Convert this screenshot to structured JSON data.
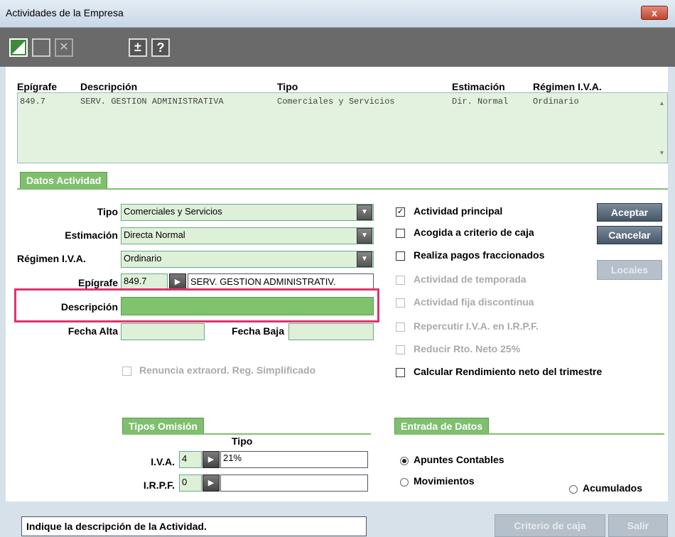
{
  "window": {
    "title": "Actividades de la Empresa",
    "close_label": "x"
  },
  "toolbar": {
    "help_label": "?"
  },
  "list": {
    "headers": [
      "Epígrafe",
      "Descripción",
      "Tipo",
      "Estimación",
      "Régimen I.V.A."
    ],
    "rows": [
      [
        "849.7",
        "SERV. GESTION ADMINISTRATIVA",
        "Comerciales y Servicios",
        "Dir. Normal",
        "Ordinario"
      ]
    ]
  },
  "datos": {
    "tab": "Datos Actividad",
    "tipo_label": "Tipo",
    "tipo_value": "Comerciales y Servicios",
    "estimacion_label": "Estimación",
    "estimacion_value": "Directa Normal",
    "regimen_label": "Régimen I.V.A.",
    "regimen_value": "Ordinario",
    "epigrafe_label": "Epígrafe",
    "epigrafe_code": "849.7",
    "epigrafe_desc": "SERV. GESTION ADMINISTRATIV.",
    "descripcion_label": "Descripción",
    "descripcion_value": "",
    "fecha_alta_label": "Fecha Alta",
    "fecha_baja_label": "Fecha Baja",
    "renuncia_label": "Renuncia extraord. Reg. Simplificado"
  },
  "checks": {
    "principal": "Actividad principal",
    "caja": "Acogida a criterio de caja",
    "fraccionados": "Realiza pagos fraccionados",
    "temporada": "Actividad de temporada",
    "discontinua": "Actividad fija discontinua",
    "repercutir": "Repercutir I.V.A. en I.R.P.F.",
    "reducir": "Reducir Rto. Neto 25%",
    "calcular": "Calcular Rendimiento neto del trimestre",
    "checkmark": "✓"
  },
  "buttons": {
    "aceptar": "Aceptar",
    "cancelar": "Cancelar",
    "locales": "Locales",
    "criterio": "Criterio de caja",
    "salir": "Salir"
  },
  "tipos": {
    "tab": "Tipos Omisión",
    "col": "Tipo",
    "iva_label": "I.V.A.",
    "iva_code": "4",
    "iva_value": "21%",
    "irpf_label": "I.R.P.F.",
    "irpf_code": "0",
    "irpf_value": ""
  },
  "entrada": {
    "tab": "Entrada de Datos",
    "apuntes": "Apuntes Contables",
    "movimientos": "Movimientos",
    "acumulados": "Acumulados"
  },
  "status": {
    "message": "Indique la descripción de la Actividad."
  },
  "colors": {
    "highlight": "#e0336a",
    "accent_green": "#7fbf6e"
  }
}
